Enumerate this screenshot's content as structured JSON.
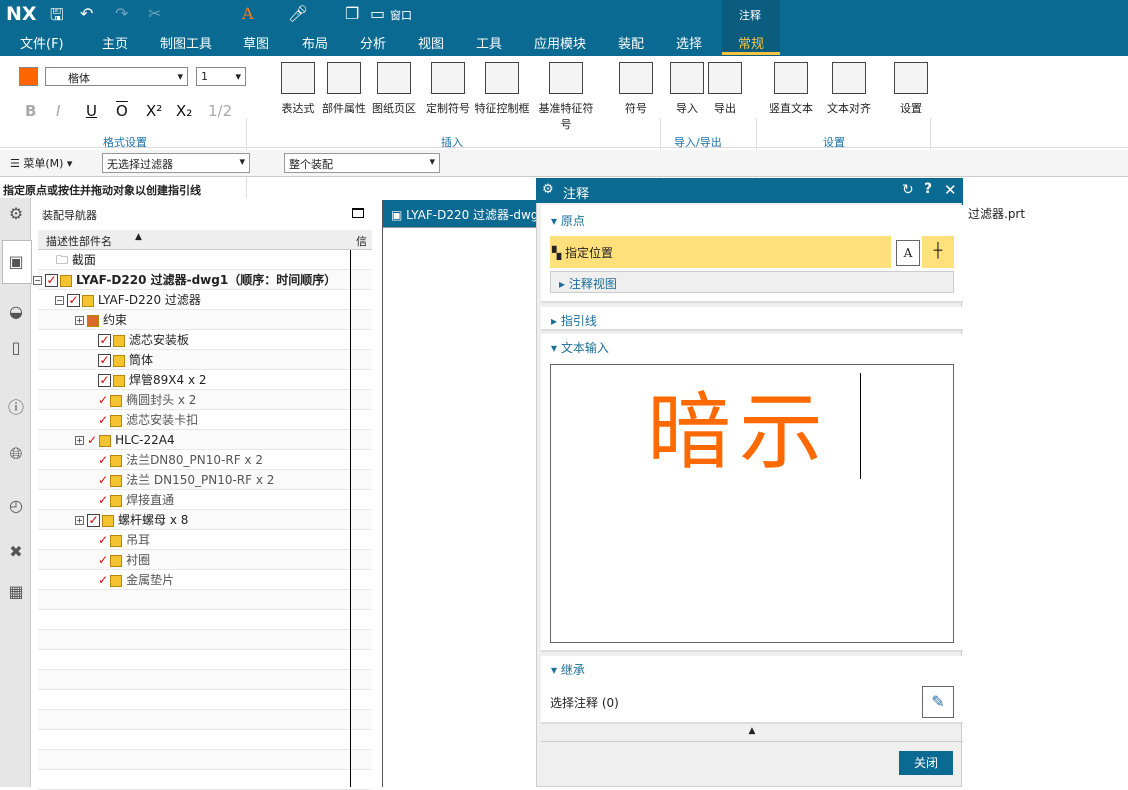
{
  "app": {
    "logo": "NX",
    "window_menu": "窗口",
    "context_tab_group": "注释"
  },
  "menu_tabs": [
    "文件(F)",
    "主页",
    "制图工具",
    "草图",
    "布局",
    "分析",
    "视图",
    "工具",
    "应用模块",
    "装配",
    "选择",
    "常规"
  ],
  "active_tab": "常规",
  "colors": {
    "brand": "#0a6a91",
    "accent_tab": "#f5c242",
    "text_color_swatch": "#ff6600",
    "highlight": "#ffe07a",
    "note_text": "#ff6a00"
  },
  "ribbon": {
    "font": "楷体",
    "size": "1",
    "format_buttons": [
      "B",
      "I",
      "U",
      "O",
      "X²",
      "X₂",
      "1/2"
    ],
    "format_group": "格式设置",
    "insert": [
      "表达式",
      "部件属性",
      "图纸页区",
      "定制符号",
      "特征控制框",
      "基准特征符号",
      "符号"
    ],
    "insert_group": "插入",
    "io": [
      "导入",
      "导出"
    ],
    "io_group": "导入/导出",
    "settings": [
      "竖直文本",
      "文本对齐",
      "设置"
    ],
    "settings_group": "设置"
  },
  "toolbar": {
    "menu": "菜单(M)",
    "filter": "无选择过滤器",
    "scope": "整个装配"
  },
  "status": "指定原点或按住并拖动对象以创建指引线",
  "navigator": {
    "title": "装配导航器",
    "col1": "描述性部件名",
    "col2": "信",
    "rows": [
      {
        "label": "截面",
        "kind": "folder"
      },
      {
        "label": "LYAF-D220 过滤器-dwg1（顺序：时间顺序）",
        "kind": "asm",
        "bold": true
      },
      {
        "label": "LYAF-D220 过滤器",
        "kind": "asm"
      },
      {
        "label": "约束",
        "kind": "con"
      },
      {
        "label": "滤芯安装板",
        "kind": "part",
        "box": true
      },
      {
        "label": "筒体",
        "kind": "part",
        "box": true
      },
      {
        "label": "焊管89X4 x 2",
        "kind": "part",
        "box": true
      },
      {
        "label": "椭圆封头 x 2",
        "kind": "part"
      },
      {
        "label": "滤芯安装卡扣",
        "kind": "part"
      },
      {
        "label": "HLC-22A4",
        "kind": "asm2"
      },
      {
        "label": "法兰DN80_PN10-RF x 2",
        "kind": "part"
      },
      {
        "label": "法兰 DN150_PN10-RF x 2",
        "kind": "part"
      },
      {
        "label": "焊接直通",
        "kind": "part"
      },
      {
        "label": "螺杆螺母 x 8",
        "kind": "asm2",
        "box": true
      },
      {
        "label": "吊耳",
        "kind": "part"
      },
      {
        "label": "衬圈",
        "kind": "part"
      },
      {
        "label": "金属垫片",
        "kind": "part"
      }
    ]
  },
  "graphics": {
    "tab_label": "LYAF-D220 过滤器-dwg",
    "tab_right": "过滤器.prt"
  },
  "dialog": {
    "title": "注释",
    "origin": "原点",
    "specify_location": "指定位置",
    "annotation_view": "注释视图",
    "leader": "指引线",
    "text_input": "文本输入",
    "text_value": "暗示",
    "inherit": "继承",
    "select_annotation": "选择注释 (0)",
    "close": "关闭"
  }
}
